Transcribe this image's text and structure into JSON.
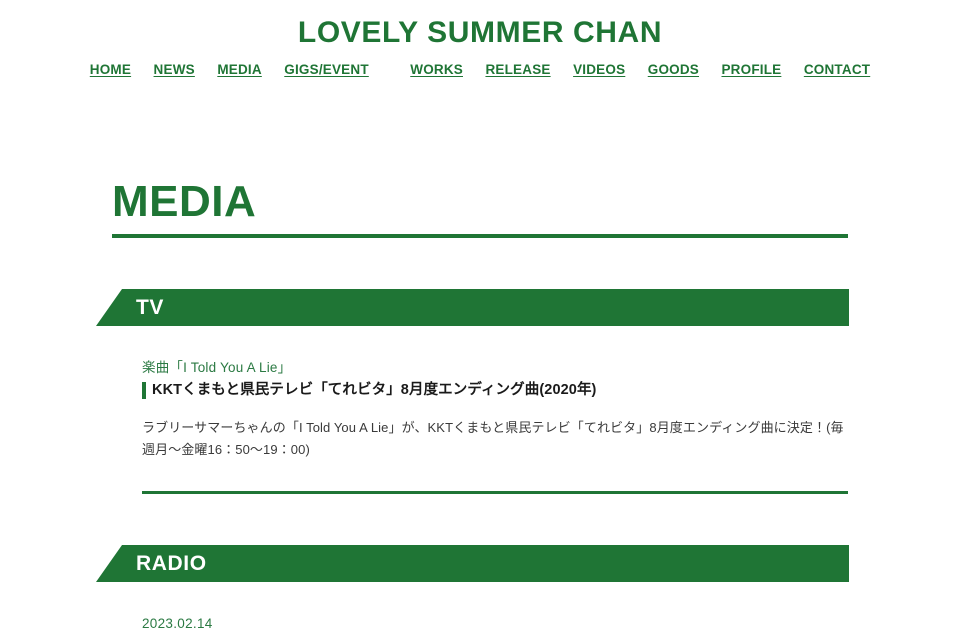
{
  "site": {
    "title": "LOVELY SUMMER CHAN"
  },
  "nav": {
    "items": [
      {
        "label": "HOME",
        "gap_after": false
      },
      {
        "label": "NEWS",
        "gap_after": false
      },
      {
        "label": "MEDIA",
        "gap_after": false
      },
      {
        "label": "GIGS/EVENT",
        "gap_after": true
      },
      {
        "label": "WORKS",
        "gap_after": false
      },
      {
        "label": "RELEASE",
        "gap_after": false
      },
      {
        "label": "VIDEOS",
        "gap_after": false
      },
      {
        "label": "GOODS",
        "gap_after": false
      },
      {
        "label": "PROFILE",
        "gap_after": false
      },
      {
        "label": "CONTACT",
        "gap_after": false
      }
    ]
  },
  "main": {
    "page_title": "MEDIA",
    "sections": [
      {
        "banner_label": "TV",
        "entries": [
          {
            "subtitle": "楽曲「I Told You A Lie」",
            "title": "KKTくまもと県民テレビ「てれビタ」8月度エンディング曲(2020年)",
            "body": "ラブリーサマーちゃんの「I Told You A Lie」が、KKTくまもと県民テレビ「てれビタ」8月度エンディング曲に決定！(毎週月〜金曜16：50〜19：00)"
          }
        ]
      },
      {
        "banner_label": "RADIO",
        "entries": [
          {
            "date": "2023.02.14"
          }
        ]
      }
    ]
  },
  "colors": {
    "brand_green": "#1f7535",
    "banner_text": "#ffffff",
    "body_text": "#3a3a3a",
    "background": "#ffffff"
  }
}
